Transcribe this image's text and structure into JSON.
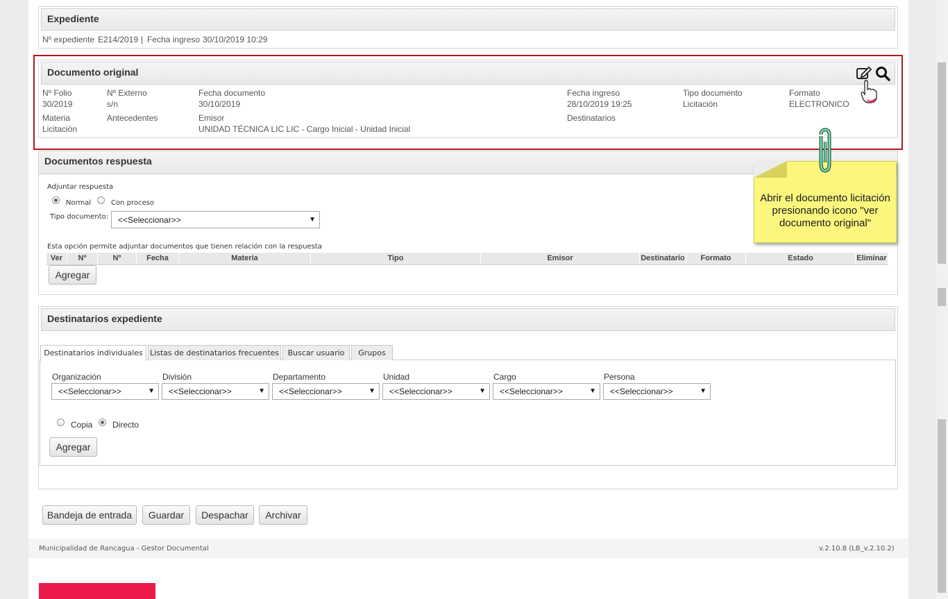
{
  "expediente": {
    "title": "Expediente",
    "numero_label": "Nº expediente",
    "numero_value": "E214/2019",
    "separator": "|",
    "fecha_label": "Fecha ingreso",
    "fecha_value": "30/10/2019 10:29"
  },
  "documento_original": {
    "title": "Documento original",
    "fields": {
      "folio_label": "Nº Folio",
      "folio_value": "30/2019",
      "externo_label": "Nº Externo",
      "externo_value": "s/n",
      "fecha_doc_label": "Fecha documento",
      "fecha_doc_value": "30/10/2019",
      "fecha_ingreso_label": "Fecha ingreso",
      "fecha_ingreso_value": "28/10/2019 19:25",
      "tipo_label": "Tipo documento",
      "tipo_value": "Licitación",
      "formato_label": "Formato",
      "formato_value": "ELECTRONICO",
      "materia_label": "Materia",
      "materia_value": "Licitación",
      "antecedentes_label": "Antecedentes",
      "emisor_label": "Emisor",
      "emisor_value": "UNIDAD TÉCNICA LIC LIC - Cargo Inicial - Unidad Inicial",
      "destinatarios_label": "Destinatarios"
    },
    "icons": [
      "edit-icon",
      "search-icon"
    ]
  },
  "callout": {
    "text": "Abrir el documento licitación presionando icono \"ver documento original\""
  },
  "documentos_respuesta": {
    "title": "Documentos respuesta",
    "adjuntar_label": "Adjuntar respuesta",
    "radio_normal": "Normal",
    "radio_proceso": "Con proceso",
    "selected_radio": "Normal",
    "tipo_documento_label": "Tipo documento:",
    "tipo_documento_value": "<<Seleccionar>>",
    "info_text": "Esta opción permite adjuntar documentos que tienen relación con la respuesta",
    "columns": [
      "Ver",
      "Nº",
      "Nº",
      "Fecha",
      "Materia",
      "Tipo",
      "Emisor",
      "Destinatario",
      "Formato",
      "Estado",
      "Eliminar"
    ],
    "agregar_label": "Agregar"
  },
  "destinatarios": {
    "title": "Destinatarios expediente",
    "tabs": [
      "Destinatarios individuales",
      "Listas de destinatarios frecuentes",
      "Buscar usuario",
      "Grupos"
    ],
    "active_tab": "Destinatarios individuales",
    "filters": [
      {
        "label": "Organización",
        "value": "<<Seleccionar>>"
      },
      {
        "label": "División",
        "value": "<<Seleccionar>>"
      },
      {
        "label": "Departamento",
        "value": "<<Seleccionar>>"
      },
      {
        "label": "Unidad",
        "value": "<<Seleccionar>>"
      },
      {
        "label": "Cargo",
        "value": "<<Seleccionar>>"
      },
      {
        "label": "Persona",
        "value": "<<Seleccionar>>"
      }
    ],
    "radio_copia": "Copia",
    "radio_directo": "Directo",
    "selected_radio": "Directo",
    "agregar_label": "Agregar"
  },
  "actions": {
    "bandeja": "Bandeja de entrada",
    "guardar": "Guardar",
    "despachar": "Despachar",
    "archivar": "Archivar"
  },
  "footer": {
    "left": "Municipalidad de Rancagua - Gestor Documental",
    "right": "v.2.10.8 (LB_v.2.10.2)"
  },
  "colors": {
    "highlight_border": "#b1171b",
    "callout_bg": "#fbf67e",
    "logo_block": "#ec1b4b"
  }
}
